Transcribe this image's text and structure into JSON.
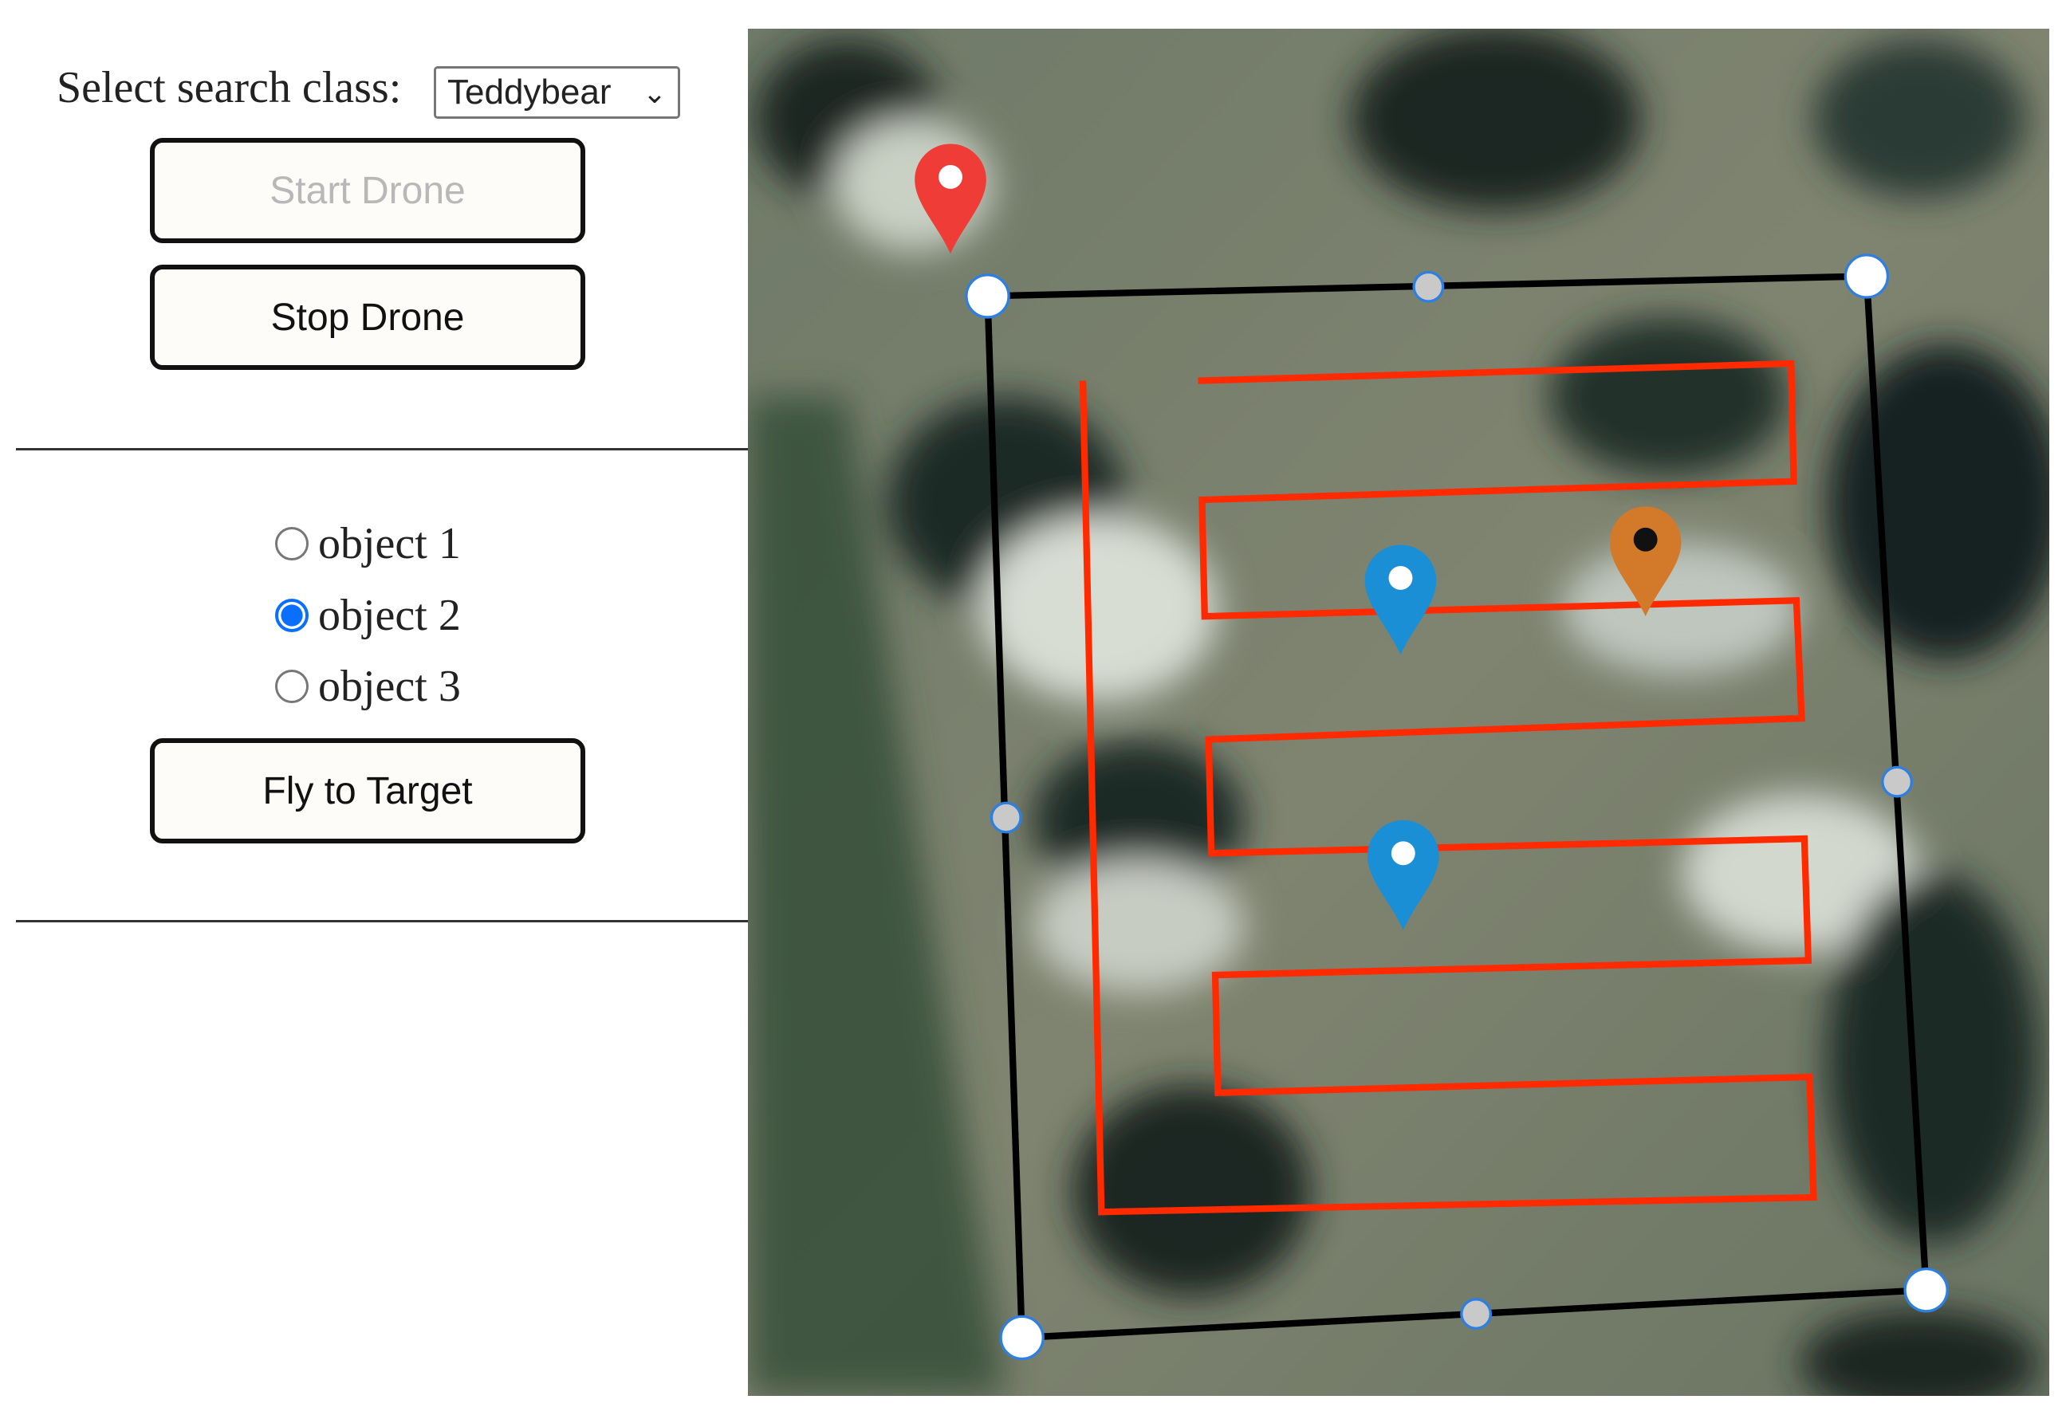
{
  "controls": {
    "search_class_label": "Select search class:",
    "search_class_value": "Teddybear",
    "start_button": "Start Drone",
    "stop_button": "Stop Drone",
    "objects": [
      {
        "label": "object 1",
        "selected": false
      },
      {
        "label": "object 2",
        "selected": true
      },
      {
        "label": "object 3",
        "selected": false
      }
    ],
    "fly_button": "Fly to Target"
  },
  "map": {
    "path_color": "#ff2a00",
    "area_border_color": "#000000",
    "markers": [
      {
        "name": "drone-start",
        "color": "#f03c36"
      },
      {
        "name": "object-1",
        "color": "#1a8fd6"
      },
      {
        "name": "object-2",
        "color": "#1a8fd6"
      },
      {
        "name": "object-3",
        "color": "#d27a2a"
      }
    ]
  }
}
